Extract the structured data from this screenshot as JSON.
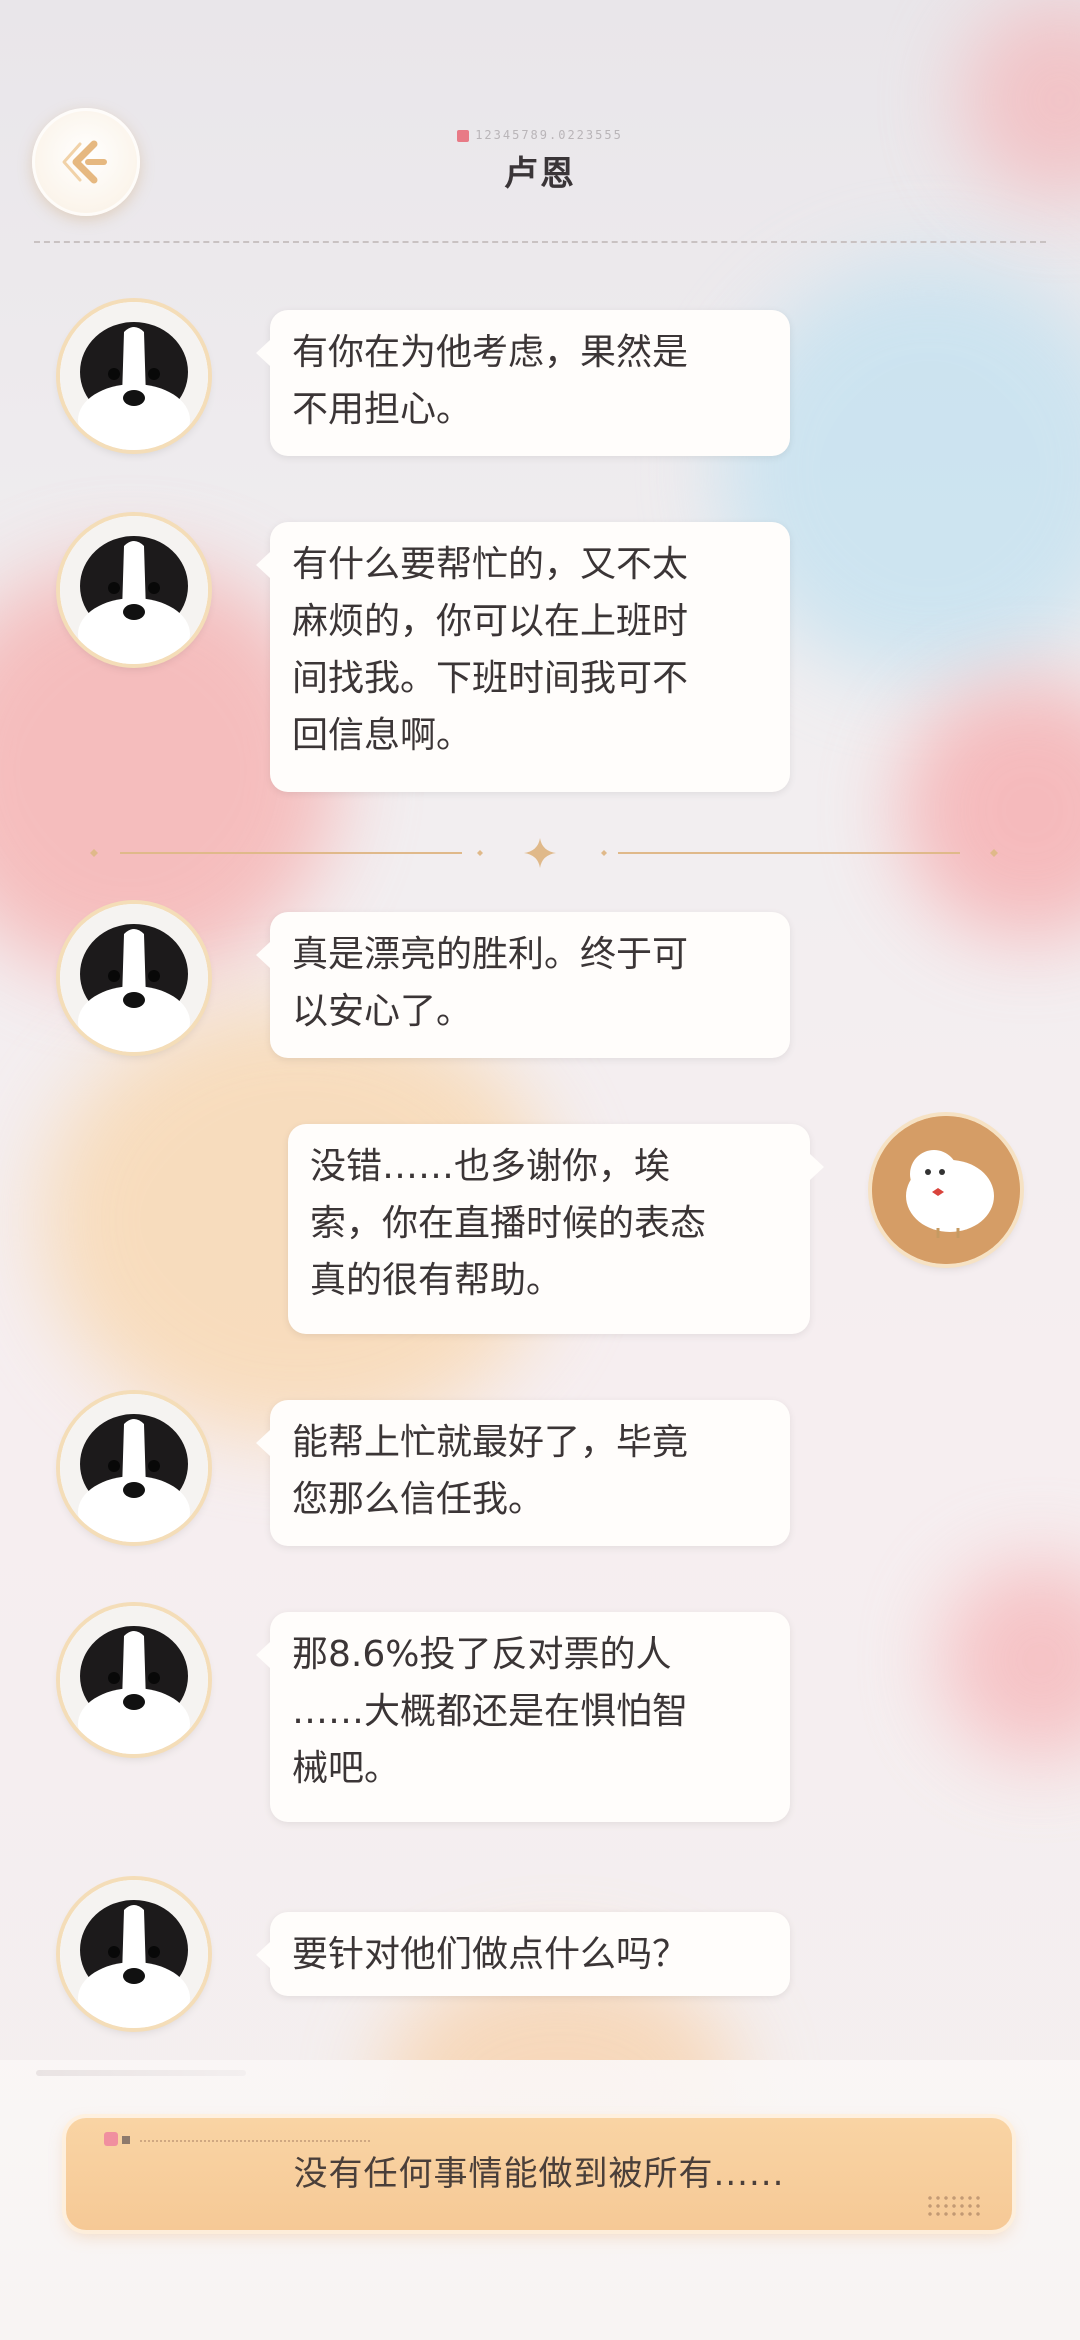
{
  "header": {
    "serial": "12345789.0223555",
    "title": "卢恩"
  },
  "messages": [
    {
      "sender": "contact",
      "text": "有你在为他考虑，果然是\n不用担心。"
    },
    {
      "sender": "contact",
      "text": "有什么要帮忙的，又不太\n麻烦的，你可以在上班时\n间找我。下班时间我可不\n回信息啊。"
    },
    {
      "sender": "contact",
      "text": "真是漂亮的胜利。终于可\n以安心了。"
    },
    {
      "sender": "me",
      "text": "没错……也多谢你，埃\n索，你在直播时候的表态\n真的很有帮助。"
    },
    {
      "sender": "contact",
      "text": "能帮上忙就最好了，毕竟\n您那么信任我。"
    },
    {
      "sender": "contact",
      "text": "那8.6%投了反对票的人\n……大概都还是在惧怕智\n械吧。"
    },
    {
      "sender": "contact",
      "text": "要针对他们做点什么吗？"
    }
  ],
  "reply": {
    "text": "没有任何事情能做到被所有......"
  },
  "colors": {
    "accent": "#f6c996",
    "bubble": "#fffdfb",
    "text": "#3b3536",
    "divider": "#e0b98a"
  },
  "icons": {
    "back": "back-arrow-icon",
    "separator": "sparkle-icon"
  }
}
